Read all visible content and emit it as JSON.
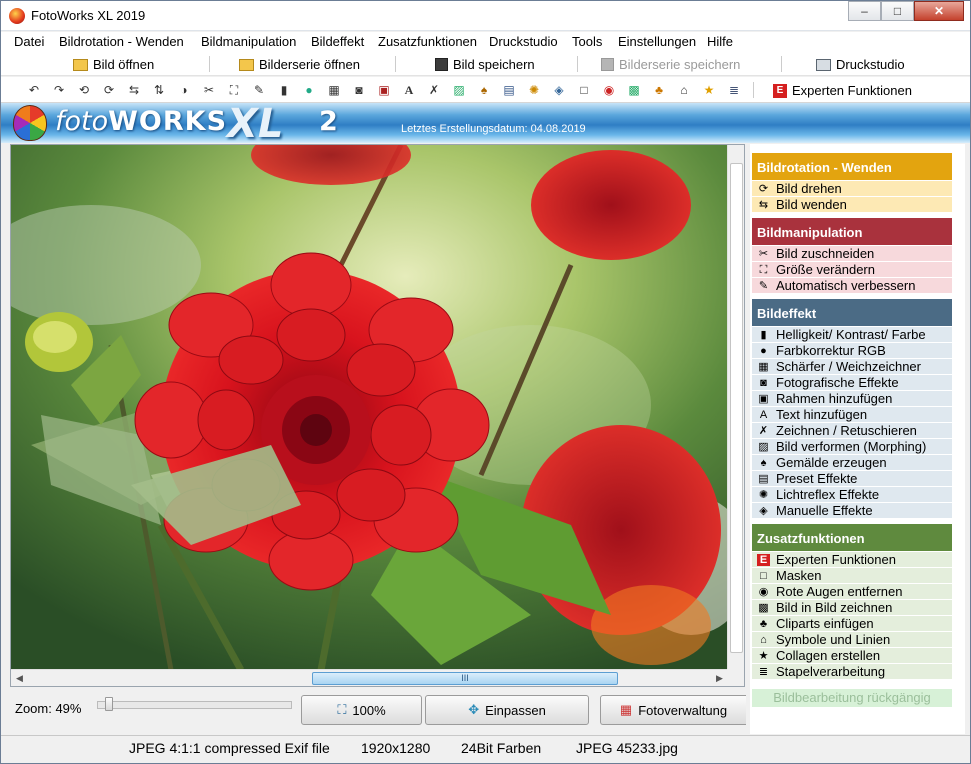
{
  "window": {
    "title": "FotoWorks XL 2019",
    "min": "–",
    "max": "□",
    "close": "✕"
  },
  "menu": [
    "Datei",
    "Bildrotation - Wenden",
    "Bildmanipulation",
    "Bildeffekt",
    "Zusatzfunktionen",
    "Druckstudio",
    "Tools",
    "Einstellungen",
    "Hilfe"
  ],
  "toolbar": {
    "open": "Bild öffnen",
    "open_series": "Bilderserie öffnen",
    "save": "Bild speichern",
    "save_series": "Bilderserie speichern",
    "print": "Druckstudio",
    "expert": "Experten Funktionen",
    "expert_badge": "E"
  },
  "banner": {
    "logo_foto": "foto",
    "logo_works": "WORKS",
    "logo_xl": "XL",
    "logo_version": "2",
    "date": "Letztes Erstellungsdatum: 04.08.2019"
  },
  "scroll": {
    "thumb_grip": "III",
    "left_arrow": "◀",
    "right_arrow": "▶"
  },
  "bottom": {
    "zoom_label": "Zoom: 49%",
    "zoom_value": 0.06,
    "btn_100": "100%",
    "btn_fit": "Einpassen",
    "btn_manager": "Fotoverwaltung"
  },
  "status": {
    "format": "JPEG 4:1:1 compressed Exif file",
    "dimensions": "1920x1280",
    "depth": "24Bit Farben",
    "filename": "JPEG 45233.jpg"
  },
  "sidebar": {
    "sections": [
      {
        "title": "Bildrotation - Wenden",
        "color": "#e3a40f",
        "item_bg": "#fde9b4",
        "items": [
          "Bild drehen",
          "Bild wenden"
        ],
        "icons": [
          "rotate-icon",
          "flip-icon"
        ]
      },
      {
        "title": "Bildmanipulation",
        "color": "#a9323d",
        "item_bg": "#f7d9dc",
        "items": [
          "Bild zuschneiden",
          "Größe verändern",
          "Automatisch verbessern"
        ],
        "icons": [
          "crop-icon",
          "resize-icon",
          "magic-icon"
        ]
      },
      {
        "title": "Bildeffekt",
        "color": "#4b6b85",
        "item_bg": "#dfe8ef",
        "items": [
          "Helligkeit/ Kontrast/ Farbe",
          "Farbkorrektur RGB",
          "Schärfer / Weichzeichner",
          "Fotografische Effekte",
          "Rahmen hinzufügen",
          "Text hinzufügen",
          "Zeichnen / Retuschieren",
          "Bild verformen (Morphing)",
          "Gemälde erzeugen",
          "Preset Effekte",
          "Lichtreflex Effekte",
          "Manuelle Effekte"
        ],
        "icons": [
          "brightness-icon",
          "rgb-icon",
          "sharpen-icon",
          "camera-icon",
          "frame-icon",
          "text-icon",
          "brush-icon",
          "morph-icon",
          "painting-icon",
          "preset-icon",
          "lensflare-icon",
          "manual-icon"
        ]
      },
      {
        "title": "Zusatzfunktionen",
        "color": "#5f8a3e",
        "item_bg": "#e4eedc",
        "items": [
          "Experten Funktionen",
          "Masken",
          "Rote Augen entfernen",
          "Bild in Bild zeichnen",
          "Cliparts einfügen",
          "Symbole und Linien",
          "Collagen erstellen",
          "Stapelverarbeitung"
        ],
        "icons": [
          "expert-icon",
          "mask-icon",
          "redeye-icon",
          "picture-in-picture-icon",
          "clipart-icon",
          "symbols-icon",
          "collage-icon",
          "batch-icon"
        ]
      }
    ],
    "undo": "Bildbearbeitung rückgängig"
  }
}
